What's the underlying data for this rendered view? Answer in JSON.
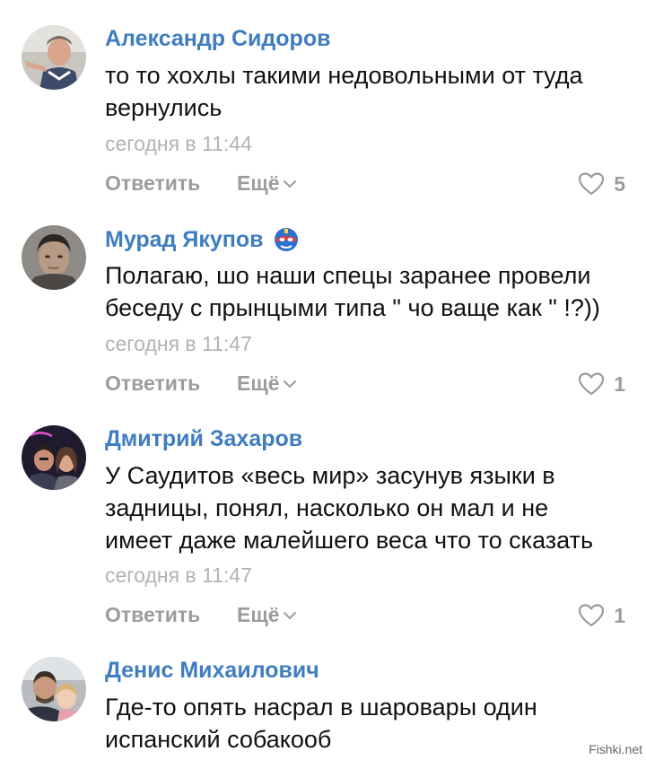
{
  "labels": {
    "reply": "Ответить",
    "more": "Ещё"
  },
  "comments": [
    {
      "author": "Александр Сидоров",
      "text": "то то хохлы такими недовольными от туда\nвернулись",
      "time": "сегодня в 11:44",
      "likes": "5",
      "avatar": "avatar-photo-man-pointing"
    },
    {
      "author": "Мурад Якупов",
      "text": "Полагаю, шо наши спецы заранее провели\nбеседу с прынцыми типа \" чо ваще как \" !?))",
      "time": "сегодня в 11:47",
      "likes": "1",
      "avatar": "avatar-photo-man-portrait",
      "badge": "superhero-mask-icon"
    },
    {
      "author": "Дмитрий Захаров",
      "text": "У Саудитов «весь мир» засунув языки в\nзадницы, понял, насколько он мал и не\nимеет даже малейшего веса что то сказать",
      "time": "сегодня в 11:47",
      "likes": "1",
      "avatar": "avatar-photo-couple-neon"
    },
    {
      "author": "Денис Михаилович",
      "text": "Где-то опять насрал в шаровары один\nиспанский собакооб",
      "avatar": "avatar-photo-man-with-child"
    }
  ],
  "watermark": "Fishki.net",
  "colors": {
    "author": "#3f7dc0",
    "text": "#111111",
    "meta": "#b3b3b3",
    "action": "#9c9c9c"
  }
}
